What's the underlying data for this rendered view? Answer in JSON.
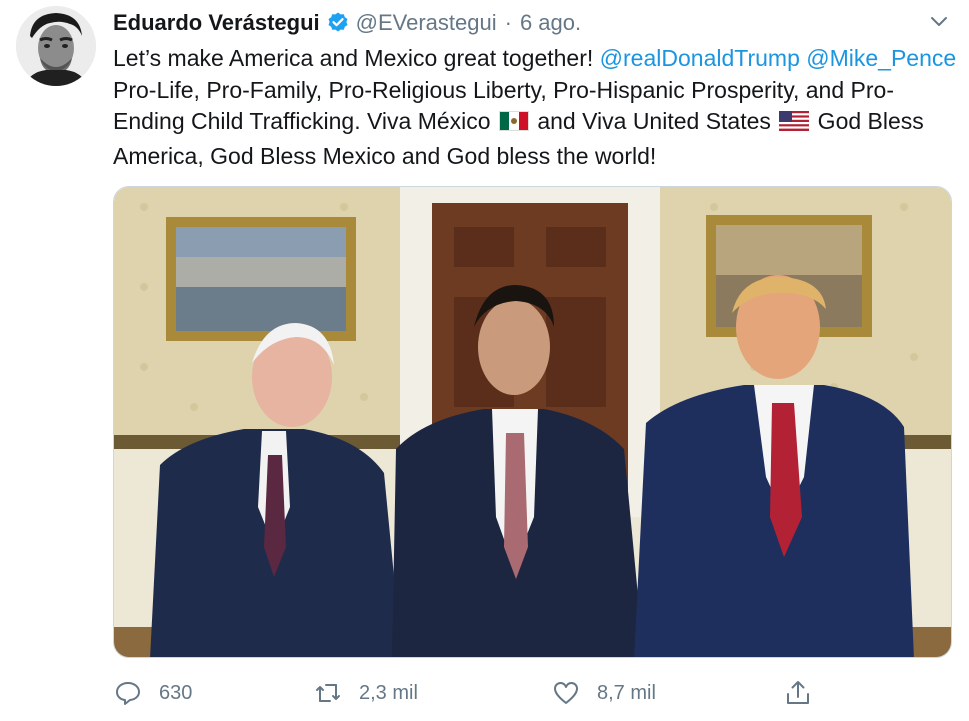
{
  "tweet": {
    "author": {
      "display_name": "Eduardo Verástegui",
      "handle": "@EVerastegui",
      "separator": "·",
      "timestamp": "6 ago.",
      "verified": true
    },
    "text": {
      "part1": "Let’s make America and Mexico great together! ",
      "mention1": "@realDonaldTrump",
      "space1": " ",
      "mention2": "@Mike_Pence",
      "part2": " Pro-Life, Pro-Family, Pro-Religious Liberty, Pro-Hispanic Prosperity, and Pro-Ending Child Trafficking. Viva México ",
      "part3": " and Viva United States ",
      "part4": " God Bless America, God Bless Mexico and God bless the world!"
    },
    "flags": [
      "mexico-flag-icon",
      "usa-flag-icon"
    ],
    "actions": {
      "reply": {
        "icon": "reply-icon",
        "count": "630"
      },
      "retweet": {
        "icon": "retweet-icon",
        "count": "2,3 mil"
      },
      "like": {
        "icon": "heart-icon",
        "count": "8,7 mil"
      },
      "share": {
        "icon": "share-icon"
      }
    },
    "colors": {
      "link": "#1b95e0",
      "muted": "#657786",
      "verified": "#1da1f2"
    }
  }
}
